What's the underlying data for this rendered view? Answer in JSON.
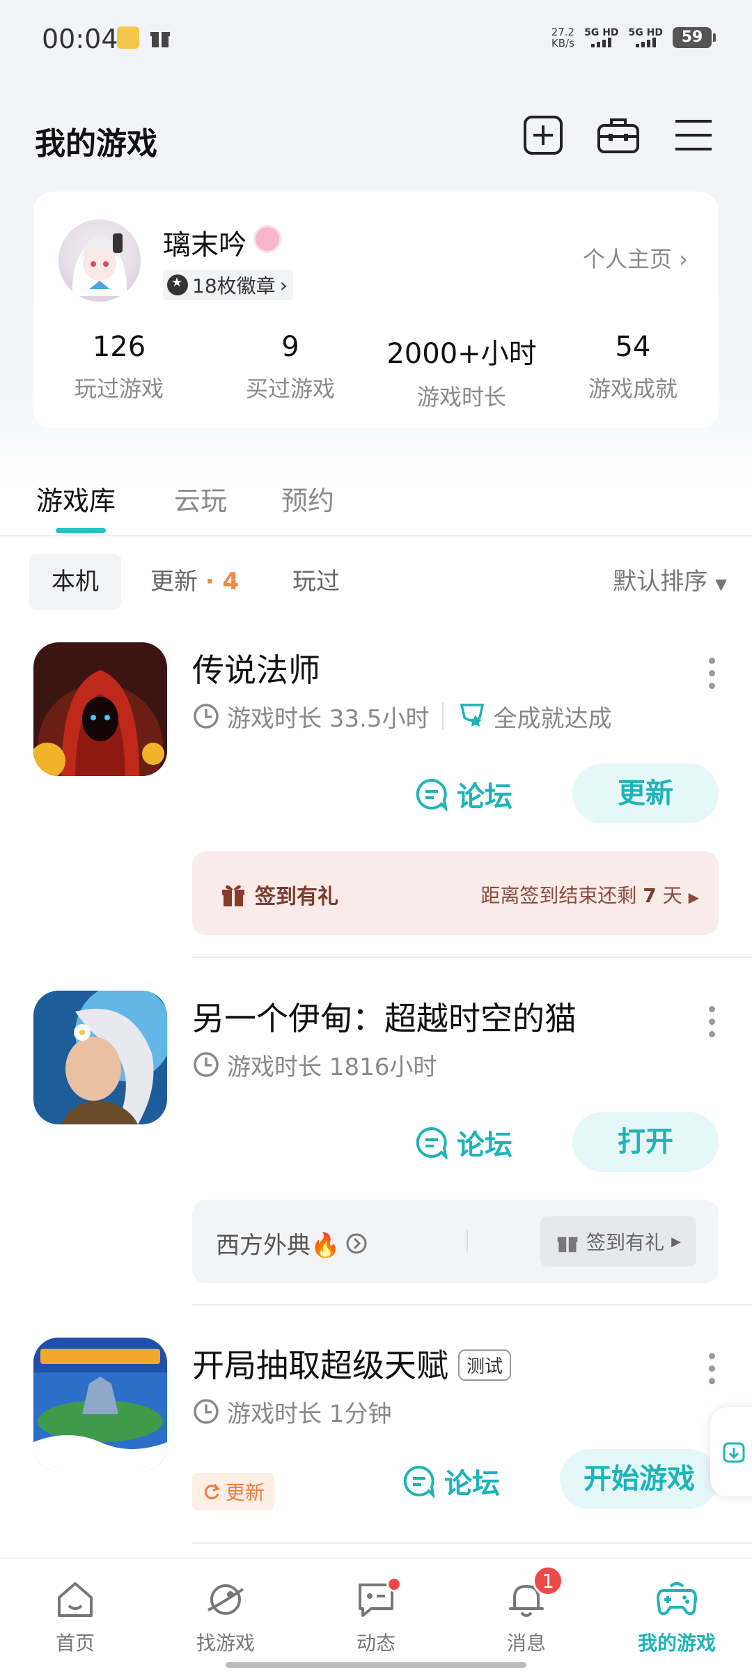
{
  "status_bar": {
    "time": "00:04",
    "speed_value": "27.2",
    "speed_unit": "KB/s",
    "net1": "5G HD",
    "net2": "5G HD",
    "battery": "59"
  },
  "header": {
    "title": "我的游戏"
  },
  "profile": {
    "username": "璃末吟",
    "badges_text": "18枚徽章",
    "homepage_link": "个人主页",
    "stats": [
      {
        "value": "126",
        "label": "玩过游戏"
      },
      {
        "value": "9",
        "label": "买过游戏"
      },
      {
        "value": "2000+小时",
        "label": "游戏时长"
      },
      {
        "value": "54",
        "label": "游戏成就"
      }
    ]
  },
  "tabs": [
    "游戏库",
    "云玩",
    "预约"
  ],
  "filters": {
    "local": "本机",
    "updates": "更新",
    "updates_count": "· 4",
    "played": "玩过",
    "sort": "默认排序"
  },
  "games": [
    {
      "name": "传说法师",
      "playtime": "游戏时长 33.5小时",
      "achievement": "全成就达成",
      "forum": "论坛",
      "action": "更新",
      "signin_label": "签到有礼",
      "signin_countdown_prefix": "距离签到结束还剩",
      "signin_countdown_days": "7",
      "signin_countdown_unit": "天"
    },
    {
      "name": "另一个伊甸：超越时空的猫",
      "playtime": "游戏时长 1816小时",
      "forum": "论坛",
      "action": "打开",
      "event_name": "西方外典🔥",
      "event_signin": "签到有礼"
    },
    {
      "name": "开局抽取超级天赋",
      "tag": "测试",
      "playtime": "游戏时长 1分钟",
      "update_tag": "更新",
      "forum": "论坛",
      "action": "开始游戏"
    }
  ],
  "bottom_nav": [
    {
      "label": "首页"
    },
    {
      "label": "找游戏"
    },
    {
      "label": "动态"
    },
    {
      "label": "消息",
      "badge": "1"
    },
    {
      "label": "我的游戏"
    }
  ],
  "colors": {
    "accent": "#1db4b8",
    "accent_bg": "#e6f7f8",
    "badge_red": "#f04848",
    "update_orange": "#f08a46"
  }
}
